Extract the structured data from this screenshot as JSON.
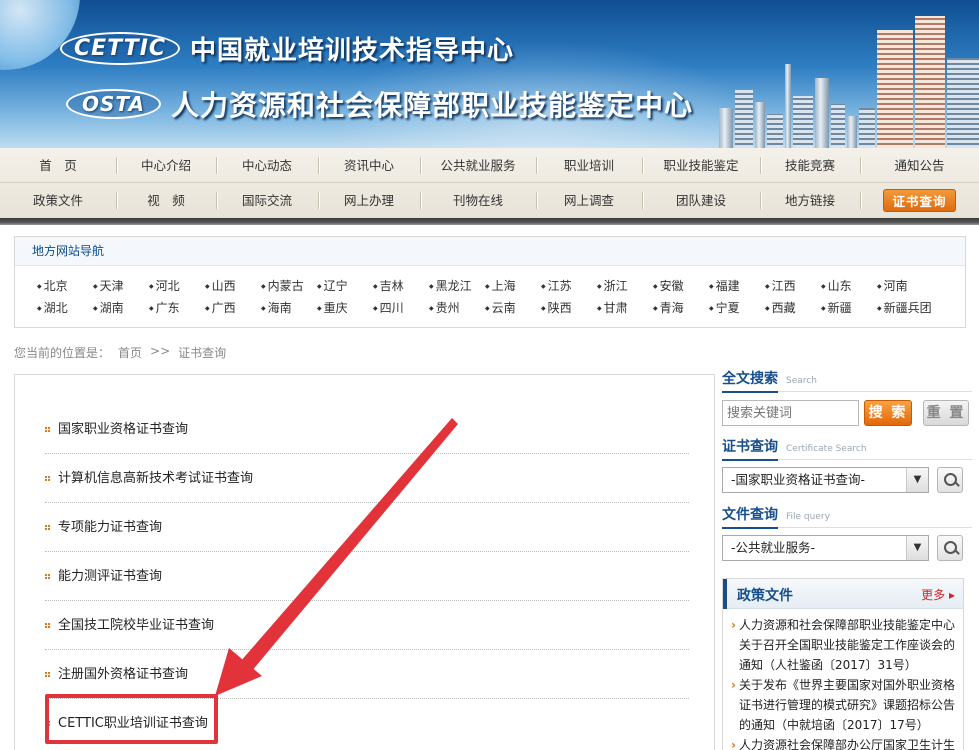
{
  "banner": {
    "logo1_badge": "CETTIC",
    "logo1_title": "中国就业培训技术指导中心",
    "logo2_badge": "OSTA",
    "logo2_title": "人力资源和社会保障部职业技能鉴定中心"
  },
  "nav": {
    "row1": [
      "首　页",
      "中心介绍",
      "中心动态",
      "资讯中心",
      "公共就业服务",
      "职业培训",
      "职业技能鉴定",
      "技能竞赛",
      "通知公告"
    ],
    "row2": [
      "政策文件",
      "视　频",
      "国际交流",
      "网上办理",
      "刊物在线",
      "网上调查",
      "团队建设",
      "地方链接"
    ],
    "cert_button": "证书查询"
  },
  "local_nav": {
    "title": "地方网站导航",
    "row1": [
      "北京",
      "天津",
      "河北",
      "山西",
      "内蒙古",
      "辽宁",
      "吉林",
      "黑龙江",
      "上海",
      "江苏",
      "浙江",
      "安徽",
      "福建",
      "江西",
      "山东",
      "河南"
    ],
    "row2": [
      "湖北",
      "湖南",
      "广东",
      "广西",
      "海南",
      "重庆",
      "四川",
      "贵州",
      "云南",
      "陕西",
      "甘肃",
      "青海",
      "宁夏",
      "西藏",
      "新疆",
      "新疆兵团"
    ]
  },
  "breadcrumb": {
    "prefix": "您当前的位置是：",
    "home": "首页",
    "sep": ">>",
    "current": "证书查询"
  },
  "cert_list": [
    "国家职业资格证书查询",
    "计算机信息高新技术考试证书查询",
    "专项能力证书查询",
    "能力测评证书查询",
    "全国技工院校毕业证书查询",
    "注册国外资格证书查询",
    "CETTIC职业培训证书查询"
  ],
  "sidebar": {
    "fulltext": {
      "title": "全文搜索",
      "title_en": "Search",
      "placeholder": "搜索关键词",
      "search_label": "搜 索",
      "reset_label": "重 置"
    },
    "cert_search": {
      "title": "证书查询",
      "title_en": "Certificate Search",
      "selected": "-国家职业资格证书查询-"
    },
    "file_query": {
      "title": "文件查询",
      "title_en": "File query",
      "selected": "-公共就业服务-"
    },
    "policy": {
      "title": "政策文件",
      "more": "更多",
      "items": [
        "人力资源和社会保障部职业技能鉴定中心关于召开全国职业技能鉴定工作座谈会的通知（人社鉴函〔2017〕31号）",
        "关于发布《世界主要国家对国外职业资格证书进行管理的模式研究》课题招标公告的通知（中就培函〔2017〕17号）",
        "人力资源社会保障部办公厅国家卫生计生委办公厅"
      ]
    }
  },
  "colors": {
    "accent_orange": "#e2660c",
    "brand_blue": "#164f8c",
    "highlight_red": "#e2333a"
  }
}
